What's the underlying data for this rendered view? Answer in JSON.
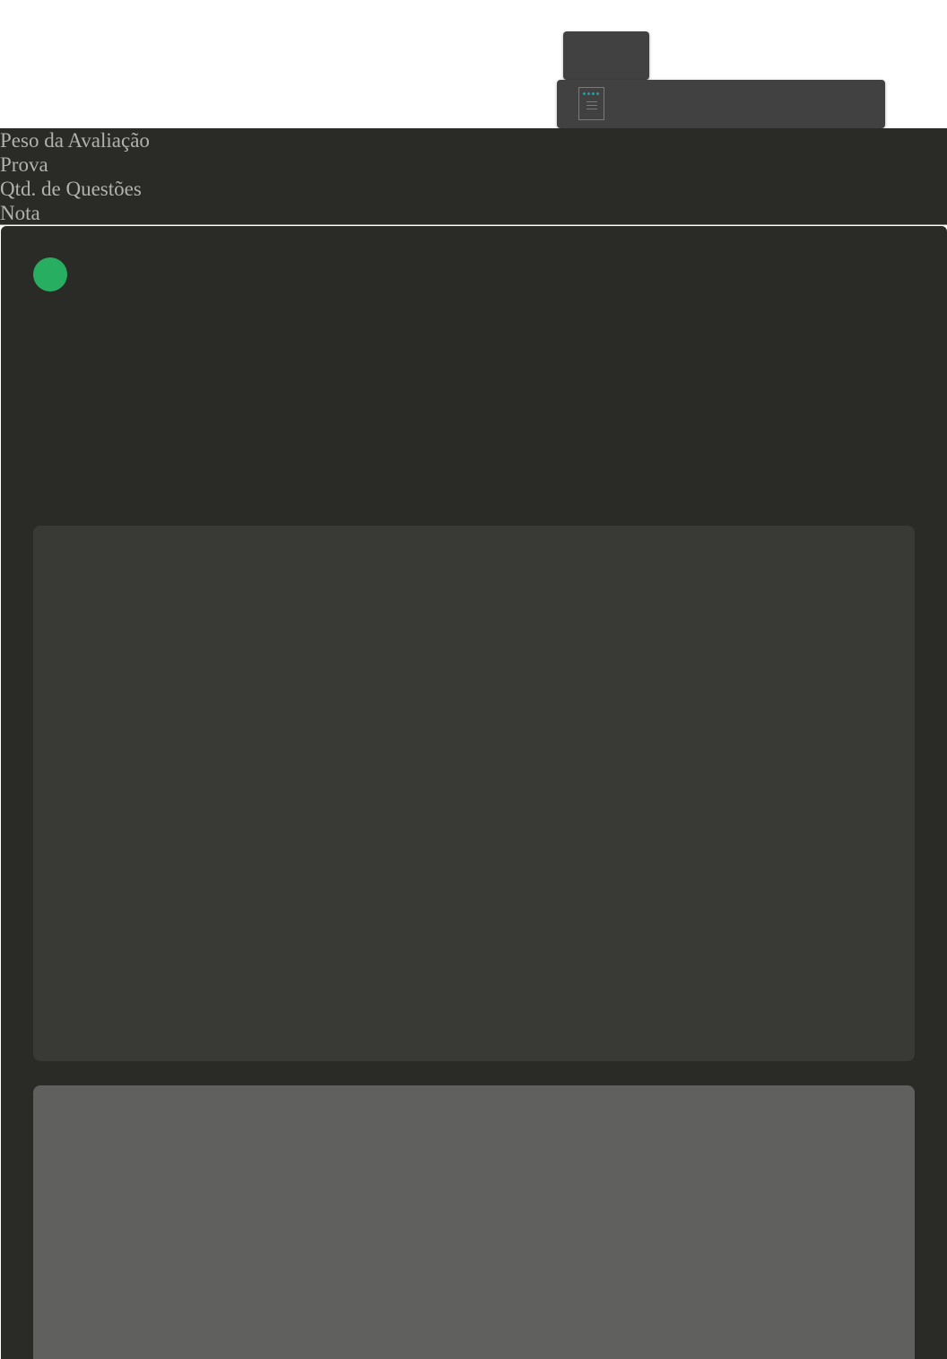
{
  "header": {
    "fields": [
      "Peso da Avaliação",
      "Prova",
      "Qtd. de Questões",
      "Nota"
    ]
  },
  "colors": {
    "panel_background": "#2a2a27",
    "card_background": "#393936",
    "footer_card_background": "#60605e",
    "status_dot": "#27ae60",
    "icon_accent": "#1aa3a3",
    "floating_bar": "#414141",
    "header_text": "#b2b2ad"
  },
  "icons": {
    "floating_bar_icon": "form-icon",
    "status": "status-dot"
  }
}
